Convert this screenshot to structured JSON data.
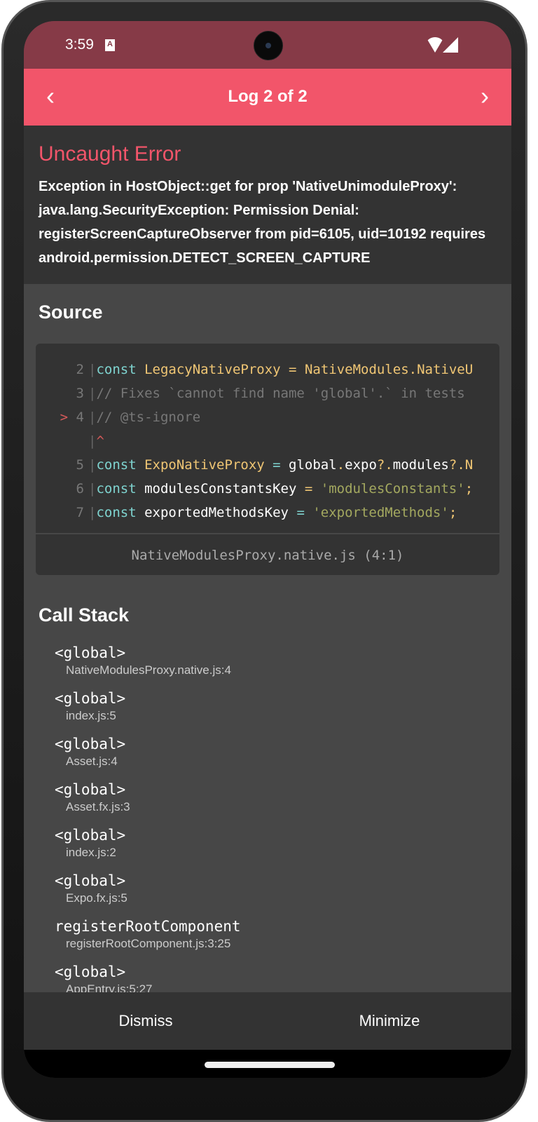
{
  "status_bar": {
    "time": "3:59",
    "notification_icon": "a-icon",
    "wifi_icon": "wifi-icon",
    "signal_icon": "signal-icon"
  },
  "header": {
    "title": "Log 2 of 2",
    "prev_icon": "chevron-left-icon",
    "next_icon": "chevron-right-icon"
  },
  "error": {
    "title": "Uncaught Error",
    "message": "Exception in HostObject::get for prop 'NativeUnimoduleProxy': java.lang.SecurityException: Permission Denial: registerScreenCaptureObserver from pid=6105, uid=10192 requires android.permission.DETECT_SCREEN_CAPTURE"
  },
  "source": {
    "title": "Source",
    "lines": [
      {
        "num": "2",
        "marker": "",
        "parts": [
          [
            "kw",
            "const"
          ],
          [
            "wh",
            " "
          ],
          [
            "yl",
            "LegacyNativeProxy"
          ],
          [
            "wh",
            " "
          ],
          [
            "yl",
            "="
          ],
          [
            "wh",
            " "
          ],
          [
            "yl",
            "NativeModules.NativeU"
          ]
        ]
      },
      {
        "num": "3",
        "marker": "",
        "parts": [
          [
            "cm",
            "// Fixes `cannot find name 'global'.` in tests"
          ]
        ]
      },
      {
        "num": "4",
        "marker": ">",
        "parts": [
          [
            "cm",
            "// @ts-ignore"
          ]
        ]
      },
      {
        "num": "",
        "marker": "",
        "parts": [
          [
            "rd",
            "^"
          ]
        ]
      },
      {
        "num": "5",
        "marker": "",
        "parts": [
          [
            "kw",
            "const"
          ],
          [
            "wh",
            " "
          ],
          [
            "yl",
            "ExpoNativeProxy"
          ],
          [
            "wh",
            " "
          ],
          [
            "kw",
            "="
          ],
          [
            "wh",
            " global"
          ],
          [
            "yl",
            "."
          ],
          [
            "wh",
            "expo"
          ],
          [
            "yl",
            "?."
          ],
          [
            "wh",
            "modules"
          ],
          [
            "yl",
            "?.N"
          ]
        ]
      },
      {
        "num": "6",
        "marker": "",
        "parts": [
          [
            "kw",
            "const"
          ],
          [
            "wh",
            " modulesConstantsKey "
          ],
          [
            "yl",
            "="
          ],
          [
            "wh",
            " "
          ],
          [
            "st",
            "'modulesConstants'"
          ],
          [
            "yl",
            ";"
          ]
        ]
      },
      {
        "num": "7",
        "marker": "",
        "parts": [
          [
            "kw",
            "const"
          ],
          [
            "wh",
            " exportedMethodsKey "
          ],
          [
            "kw",
            "="
          ],
          [
            "wh",
            " "
          ],
          [
            "st",
            "'exportedMethods'"
          ],
          [
            "yl",
            ";"
          ]
        ]
      }
    ],
    "location": "NativeModulesProxy.native.js (4:1)"
  },
  "call_stack": {
    "title": "Call Stack",
    "frames": [
      {
        "fn": "<global>",
        "file": "NativeModulesProxy.native.js:4"
      },
      {
        "fn": "<global>",
        "file": "index.js:5"
      },
      {
        "fn": "<global>",
        "file": "Asset.js:4"
      },
      {
        "fn": "<global>",
        "file": "Asset.fx.js:3"
      },
      {
        "fn": "<global>",
        "file": "index.js:2"
      },
      {
        "fn": "<global>",
        "file": "Expo.fx.js:5"
      },
      {
        "fn": "registerRootComponent",
        "file": "registerRootComponent.js:3:25"
      },
      {
        "fn": "<global>",
        "file": "AppEntry.js:5:27"
      }
    ]
  },
  "footer": {
    "dismiss": "Dismiss",
    "minimize": "Minimize"
  },
  "colors": {
    "accent": "#F2556A",
    "status_bar": "#863A47",
    "panel": "#333333",
    "background": "#474747"
  }
}
